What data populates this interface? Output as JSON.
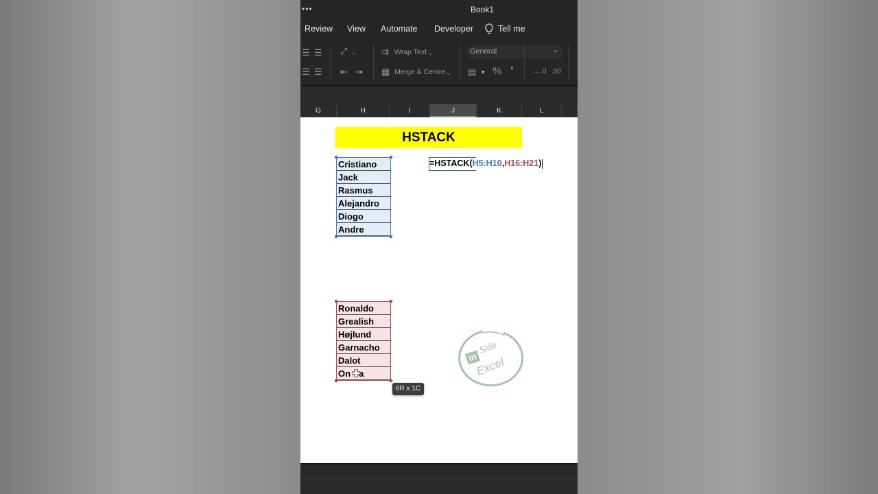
{
  "window": {
    "title": "Book1",
    "more_glyph": "•••"
  },
  "menu": {
    "items": [
      "Review",
      "View",
      "Automate",
      "Developer"
    ],
    "tell_me": "Tell me"
  },
  "ribbon": {
    "wrap_text": "Wrap Text",
    "merge_centre": "Merge & Centre",
    "number_format": "General",
    "percent_glyph": "%",
    "comma_glyph": "❜"
  },
  "columns": [
    "G",
    "H",
    "I",
    "J",
    "K",
    "L"
  ],
  "active_column": "J",
  "sheet": {
    "banner": "HSTACK",
    "first_names": [
      "Cristiano",
      "Jack",
      "Rasmus",
      "Alejandro",
      "Diogo",
      "Andre"
    ],
    "last_names": [
      "Ronaldo",
      "Grealish",
      "Højlund",
      "Garnacho",
      "Dalot",
      "On",
      "a"
    ],
    "formula": {
      "prefix": "=HSTACK(",
      "range1": "H5:H10",
      "comma": ",",
      "range2": "H16:H21",
      "suffix": ")"
    },
    "selection_tooltip": "6R x 1C"
  },
  "watermark": {
    "in": "in",
    "side": "Side",
    "excel": "Excel"
  },
  "colors": {
    "banner": "#ffff00",
    "range1": "#3f76c7",
    "range2": "#b4464b",
    "active_cell_border": "#2e7d46",
    "watermark": "#a7c4ab"
  }
}
